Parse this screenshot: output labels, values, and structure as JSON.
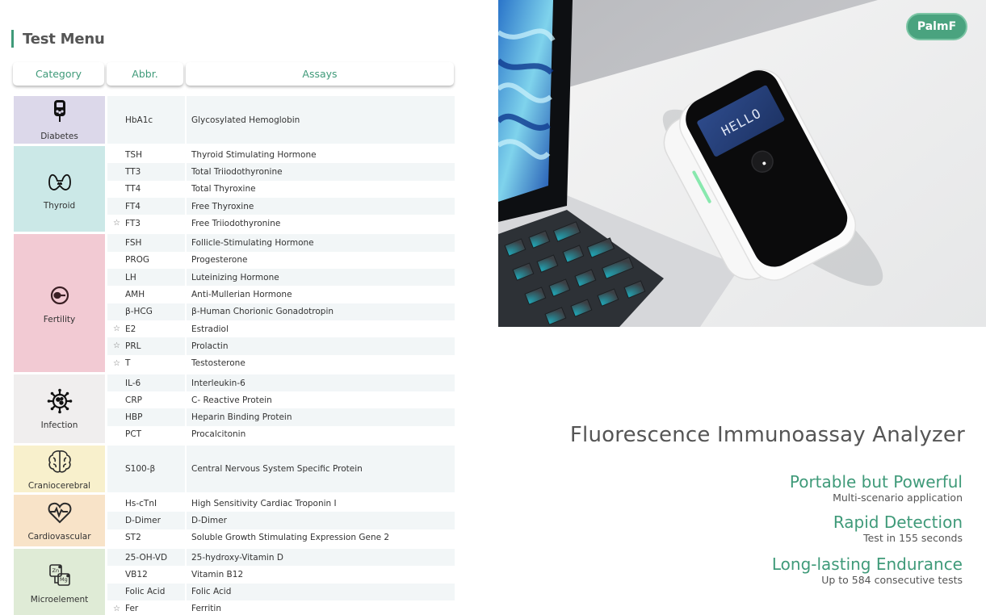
{
  "page": {
    "title": "Test Menu",
    "accent_color": "#3f9a79"
  },
  "table": {
    "headers": {
      "category": "Category",
      "abbr": "Abbr.",
      "assays": "Assays"
    },
    "groups": [
      {
        "category": "Diabetes",
        "icon": "glucose-meter-icon",
        "color": "#dcd8ea",
        "rows": [
          {
            "star": false,
            "abbr": "HbA1c",
            "assay": "Glycosylated Hemoglobin"
          }
        ]
      },
      {
        "category": "Thyroid",
        "icon": "thyroid-icon",
        "color": "#cbe8e7",
        "rows": [
          {
            "star": false,
            "abbr": "TSH",
            "assay": "Thyroid Stimulating Hormone"
          },
          {
            "star": false,
            "abbr": "TT3",
            "assay": "Total Triiodothyronine"
          },
          {
            "star": false,
            "abbr": "TT4",
            "assay": "Total Thyroxine"
          },
          {
            "star": false,
            "abbr": "FT4",
            "assay": "Free Thyroxine"
          },
          {
            "star": true,
            "abbr": "FT3",
            "assay": "Free Triiodothyronine"
          }
        ]
      },
      {
        "category": "Fertility",
        "icon": "sperm-egg-icon",
        "color": "#f2cad3",
        "rows": [
          {
            "star": false,
            "abbr": "FSH",
            "assay": "Follicle-Stimulating Hormone"
          },
          {
            "star": false,
            "abbr": "PROG",
            "assay": "Progesterone"
          },
          {
            "star": false,
            "abbr": "LH",
            "assay": "Luteinizing Hormone"
          },
          {
            "star": false,
            "abbr": "AMH",
            "assay": "Anti-Mullerian Hormone"
          },
          {
            "star": false,
            "abbr": "β-HCG",
            "assay": "β-Human Chorionic Gonadotropin"
          },
          {
            "star": true,
            "abbr": "E2",
            "assay": "Estradiol"
          },
          {
            "star": true,
            "abbr": "PRL",
            "assay": "Prolactin"
          },
          {
            "star": true,
            "abbr": "T",
            "assay": "Testosterone"
          }
        ]
      },
      {
        "category": "Infection",
        "icon": "virus-icon",
        "color": "#f0eeee",
        "rows": [
          {
            "star": false,
            "abbr": "IL-6",
            "assay": "Interleukin-6"
          },
          {
            "star": false,
            "abbr": "CRP",
            "assay": "C- Reactive Protein"
          },
          {
            "star": false,
            "abbr": "HBP",
            "assay": "Heparin Binding Protein"
          },
          {
            "star": false,
            "abbr": "PCT",
            "assay": "Procalcitonin"
          }
        ]
      },
      {
        "category": "Craniocerebral",
        "icon": "brain-icon",
        "color": "#f8f0cc",
        "rows": [
          {
            "star": false,
            "abbr": "S100-β",
            "assay": "Central Nervous System Specific Protein"
          }
        ]
      },
      {
        "category": "Cardiovascular",
        "icon": "heart-pulse-icon",
        "color": "#f8e3c8",
        "rows": [
          {
            "star": false,
            "abbr": "Hs-cTnI",
            "assay": "High Sensitivity Cardiac Troponin I"
          },
          {
            "star": false,
            "abbr": "D-Dimer",
            "assay": "D-Dimer"
          },
          {
            "star": false,
            "abbr": "ST2",
            "assay": "Soluble Growth Stimulating Expression Gene 2"
          }
        ]
      },
      {
        "category": "Microelement",
        "icon": "elements-icon",
        "color": "#dfebd6",
        "rows": [
          {
            "star": false,
            "abbr": "25-OH-VD",
            "assay": "25-hydroxy-Vitamin D"
          },
          {
            "star": false,
            "abbr": "VB12",
            "assay": "Vitamin B12"
          },
          {
            "star": false,
            "abbr": "Folic Acid",
            "assay": "Folic Acid"
          },
          {
            "star": true,
            "abbr": "Fer",
            "assay": "Ferritin"
          }
        ]
      }
    ],
    "star_glyph": "☆"
  },
  "photo": {
    "brand": "PalmF",
    "device_screen_text": "HELLO",
    "brand_color": "#4aa37f"
  },
  "product": {
    "title": "Fluorescence Immunoassay Analyzer",
    "features": [
      {
        "heading": "Portable but Powerful",
        "sub": "Multi-scenario application"
      },
      {
        "heading": "Rapid Detection",
        "sub": "Test in 155 seconds"
      },
      {
        "heading": "Long-lasting Endurance",
        "sub": "Up to 584 consecutive tests"
      }
    ]
  }
}
